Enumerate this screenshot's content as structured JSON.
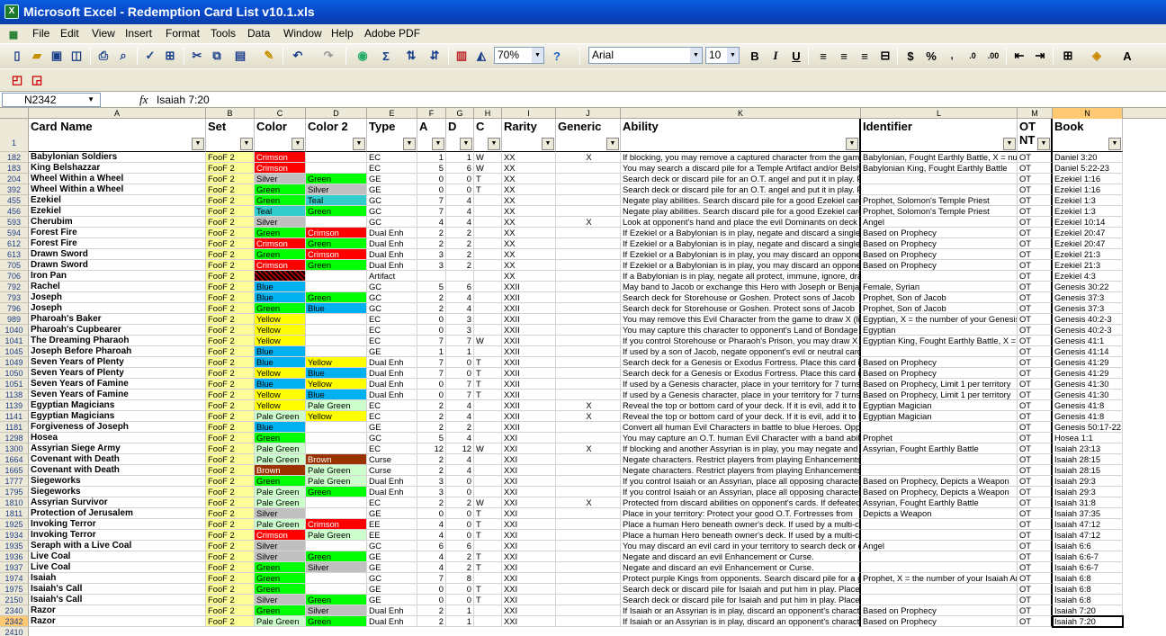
{
  "window": {
    "title": "Microsoft Excel - Redemption Card List v10.1.xls"
  },
  "menu": [
    "File",
    "Edit",
    "View",
    "Insert",
    "Format",
    "Tools",
    "Data",
    "Window",
    "Help",
    "Adobe PDF"
  ],
  "toolbar": {
    "zoom": "70%",
    "font": "Arial",
    "size": "10"
  },
  "formula_bar": {
    "name_box": "N2342",
    "fx": "fx",
    "value": "Isaiah 7:20"
  },
  "columns": [
    "A",
    "B",
    "C",
    "D",
    "E",
    "F",
    "G",
    "H",
    "I",
    "J",
    "K",
    "L",
    "M",
    "N"
  ],
  "headers": [
    "Card Name",
    "Set",
    "Color",
    "Color 2",
    "Type",
    "A",
    "D",
    "C",
    "Rarity",
    "Generic",
    "Ability",
    "Identifier",
    "OT NT",
    "Book"
  ],
  "header_row_num": "1",
  "last_row_num": "2410",
  "colors": {
    "Crimson": "#ff0000",
    "Silver": "#c0c0c0",
    "Green": "#00ff00",
    "Teal": "#33cccc",
    "Blue": "#00b0f0",
    "Yellow": "#ffff00",
    "Pale Green": "#ccffcc",
    "Brown": "#993300",
    "set": "#ffff99"
  },
  "rows": [
    {
      "n": "182",
      "name": "Babylonian Soldiers",
      "set": "FooF 2",
      "color": "Crimson",
      "color2": "",
      "type": "EC",
      "a": "1",
      "d": "1",
      "c": "W",
      "rarity": "XX",
      "generic": "X",
      "ability": "If blocking, you may remove a captured character from the game",
      "ident": "Babylonian, Fought Earthly Battle, X = num",
      "ot": "OT",
      "book": "Daniel 3:20"
    },
    {
      "n": "183",
      "name": "King Belshazzar",
      "set": "FooF 2",
      "color": "Crimson",
      "color2": "",
      "type": "EC",
      "a": "5",
      "d": "6",
      "c": "W",
      "rarity": "XX",
      "generic": "",
      "ability": "You may search a discard pile for a Temple Artifact and/or Belshazzar",
      "ident": "Babylonian King, Fought Earthly Battle",
      "ot": "OT",
      "book": "Daniel 5:22-23"
    },
    {
      "n": "204",
      "name": "Wheel Within a Wheel",
      "set": "FooF 2",
      "color": "Silver",
      "color2": "Green",
      "type": "GE",
      "a": "0",
      "d": "0",
      "c": "T",
      "rarity": "XX",
      "generic": "",
      "ability": "Search deck or discard pile for an O.T. angel and put it in play. Place",
      "ident": "",
      "ot": "OT",
      "book": "Ezekiel 1:16"
    },
    {
      "n": "392",
      "name": "Wheel Within a Wheel",
      "set": "FooF 2",
      "color": "Green",
      "color2": "Silver",
      "type": "GE",
      "a": "0",
      "d": "0",
      "c": "T",
      "rarity": "XX",
      "generic": "",
      "ability": "Search deck or discard pile for an O.T. angel and put it in play. Place",
      "ident": "",
      "ot": "OT",
      "book": "Ezekiel 1:16"
    },
    {
      "n": "455",
      "name": "Ezekiel",
      "set": "FooF 2",
      "color": "Green",
      "color2": "Teal",
      "type": "GC",
      "a": "7",
      "d": "4",
      "c": "",
      "rarity": "XX",
      "generic": "",
      "ability": "Negate play abilities. Search discard pile for a good Ezekiel card",
      "ident": "Prophet, Solomon's Temple Priest",
      "ot": "OT",
      "book": "Ezekiel 1:3"
    },
    {
      "n": "456",
      "name": "Ezekiel",
      "set": "FooF 2",
      "color": "Teal",
      "color2": "Green",
      "type": "GC",
      "a": "7",
      "d": "4",
      "c": "",
      "rarity": "XX",
      "generic": "",
      "ability": "Negate play abilities. Search discard pile for a good Ezekiel card",
      "ident": "Prophet, Solomon's Temple Priest",
      "ot": "OT",
      "book": "Ezekiel 1:3"
    },
    {
      "n": "593",
      "name": "Cherubim",
      "set": "FooF 2",
      "color": "Silver",
      "color2": "",
      "type": "GC",
      "a": "4",
      "d": "4",
      "c": "",
      "rarity": "XX",
      "generic": "X",
      "ability": "Look at opponent's hand and place the evil Dominants on deck",
      "ident": "Angel",
      "ot": "OT",
      "book": "Ezekiel 10:14"
    },
    {
      "n": "594",
      "name": "Forest Fire",
      "set": "FooF 2",
      "color": "Green",
      "color2": "Crimson",
      "type": "Dual Enh",
      "a": "2",
      "d": "2",
      "c": "",
      "rarity": "XX",
      "generic": "",
      "ability": "If Ezekiel or a Babylonian is in play, negate and discard a single card",
      "ident": "Based on Prophecy",
      "ot": "OT",
      "book": "Ezekiel 20:47"
    },
    {
      "n": "612",
      "name": "Forest Fire",
      "set": "FooF 2",
      "color": "Crimson",
      "color2": "Green",
      "type": "Dual Enh",
      "a": "2",
      "d": "2",
      "c": "",
      "rarity": "XX",
      "generic": "",
      "ability": "If Ezekiel or a Babylonian is in play, negate and discard a single card",
      "ident": "Based on Prophecy",
      "ot": "OT",
      "book": "Ezekiel 20:47"
    },
    {
      "n": "613",
      "name": "Drawn Sword",
      "set": "FooF 2",
      "color": "Green",
      "color2": "Crimson",
      "type": "Dual Enh",
      "a": "3",
      "d": "2",
      "c": "",
      "rarity": "XX",
      "generic": "",
      "ability": "If Ezekiel or a Babylonian is in play, you may discard an opponent's",
      "ident": "Based on Prophecy",
      "ot": "OT",
      "book": "Ezekiel 21:3"
    },
    {
      "n": "705",
      "name": "Drawn Sword",
      "set": "FooF 2",
      "color": "Crimson",
      "color2": "Green",
      "type": "Dual Enh",
      "a": "3",
      "d": "2",
      "c": "",
      "rarity": "XX",
      "generic": "",
      "ability": "If Ezekiel or a Babylonian is in play, you may discard an opponent's",
      "ident": "Based on Prophecy",
      "ot": "OT",
      "book": "Ezekiel 21:3"
    },
    {
      "n": "706",
      "name": "Iron Pan",
      "set": "FooF 2",
      "color": "hatch",
      "color2": "",
      "type": "Artifact",
      "a": "",
      "d": "",
      "c": "",
      "rarity": "XX",
      "generic": "",
      "ability": "If a Babylonian is in play, negate all protect, immune, ignore, draw",
      "ident": "",
      "ot": "OT",
      "book": "Ezekiel 4:3"
    },
    {
      "n": "792",
      "name": "Rachel",
      "set": "FooF 2",
      "color": "Blue",
      "color2": "",
      "type": "GC",
      "a": "5",
      "d": "6",
      "c": "",
      "rarity": "XXII",
      "generic": "",
      "ability": "May band to Jacob or exchange this Hero with Joseph or Benjamin",
      "ident": "Female, Syrian",
      "ot": "OT",
      "book": "Genesis 30:22"
    },
    {
      "n": "793",
      "name": "Joseph",
      "set": "FooF 2",
      "color": "Blue",
      "color2": "Green",
      "type": "GC",
      "a": "2",
      "d": "4",
      "c": "",
      "rarity": "XXII",
      "generic": "",
      "ability": "Search deck for Storehouse or Goshen. Protect sons of Jacob",
      "ident": "Prophet, Son of Jacob",
      "ot": "OT",
      "book": "Genesis 37:3"
    },
    {
      "n": "796",
      "name": "Joseph",
      "set": "FooF 2",
      "color": "Green",
      "color2": "Blue",
      "type": "GC",
      "a": "2",
      "d": "4",
      "c": "",
      "rarity": "XXII",
      "generic": "",
      "ability": "Search deck for Storehouse or Goshen. Protect sons of Jacob",
      "ident": "Prophet, Son of Jacob",
      "ot": "OT",
      "book": "Genesis 37:3"
    },
    {
      "n": "989",
      "name": "Pharoah's Baker",
      "set": "FooF 2",
      "color": "Yellow",
      "color2": "",
      "type": "EC",
      "a": "0",
      "d": "3",
      "c": "",
      "rarity": "XXII",
      "generic": "",
      "ability": "You may remove this Evil Character from the game to draw X (limit",
      "ident": "Egyptian, X = the number of your Genesis H",
      "ot": "OT",
      "book": "Genesis 40:2-3"
    },
    {
      "n": "1040",
      "name": "Pharoah's Cupbearer",
      "set": "FooF 2",
      "color": "Yellow",
      "color2": "",
      "type": "EC",
      "a": "0",
      "d": "3",
      "c": "",
      "rarity": "XXII",
      "generic": "",
      "ability": "You may capture this character to opponent's Land of Bondage",
      "ident": "Egyptian",
      "ot": "OT",
      "book": "Genesis 40:2-3"
    },
    {
      "n": "1041",
      "name": "The Dreaming Pharaoh",
      "set": "FooF 2",
      "color": "Yellow",
      "color2": "",
      "type": "EC",
      "a": "7",
      "d": "7",
      "c": "W",
      "rarity": "XXII",
      "generic": "",
      "ability": "If you control Storehouse or Pharaoh's Prison, you may draw X",
      "ident": "Egyptian King, Fought Earthly Battle, X = th",
      "ot": "OT",
      "book": "Genesis 41:1"
    },
    {
      "n": "1045",
      "name": "Joseph Before Pharoah",
      "set": "FooF 2",
      "color": "Blue",
      "color2": "",
      "type": "GE",
      "a": "1",
      "d": "1",
      "c": "",
      "rarity": "XXII",
      "generic": "",
      "ability": "If used by a son of Jacob, negate opponent's evil or neutral card",
      "ident": "",
      "ot": "OT",
      "book": "Genesis 41:14"
    },
    {
      "n": "1049",
      "name": "Seven Years of Plenty",
      "set": "FooF 2",
      "color": "Blue",
      "color2": "Yellow",
      "type": "Dual Enh",
      "a": "7",
      "d": "0",
      "c": "T",
      "rarity": "XXII",
      "generic": "",
      "ability": "Search deck for a Genesis or Exodus Fortress. Place this card in",
      "ident": "Based on Prophecy",
      "ot": "OT",
      "book": "Genesis 41:29"
    },
    {
      "n": "1050",
      "name": "Seven Years of Plenty",
      "set": "FooF 2",
      "color": "Yellow",
      "color2": "Blue",
      "type": "Dual Enh",
      "a": "7",
      "d": "0",
      "c": "T",
      "rarity": "XXII",
      "generic": "",
      "ability": "Search deck for a Genesis or Exodus Fortress. Place this card in",
      "ident": "Based on Prophecy",
      "ot": "OT",
      "book": "Genesis 41:29"
    },
    {
      "n": "1051",
      "name": "Seven Years of Famine",
      "set": "FooF 2",
      "color": "Blue",
      "color2": "Yellow",
      "type": "Dual Enh",
      "a": "0",
      "d": "7",
      "c": "T",
      "rarity": "XXII",
      "generic": "",
      "ability": "If used by a Genesis character, place in your territory for 7 turns:",
      "ident": "Based on Prophecy, Limit 1 per territory",
      "ot": "OT",
      "book": "Genesis 41:30"
    },
    {
      "n": "1138",
      "name": "Seven Years of Famine",
      "set": "FooF 2",
      "color": "Yellow",
      "color2": "Blue",
      "type": "Dual Enh",
      "a": "0",
      "d": "7",
      "c": "T",
      "rarity": "XXII",
      "generic": "",
      "ability": "If used by a Genesis character, place in your territory for 7 turns:",
      "ident": "Based on Prophecy, Limit 1 per territory",
      "ot": "OT",
      "book": "Genesis 41:30"
    },
    {
      "n": "1139",
      "name": "Egyptian Magicians",
      "set": "FooF 2",
      "color": "Yellow",
      "color2": "Pale Green",
      "type": "EC",
      "a": "2",
      "d": "4",
      "c": "",
      "rarity": "XXII",
      "generic": "X",
      "ability": "Reveal the top or bottom card of your deck. If it is evil, add it to hand",
      "ident": "Egyptian Magician",
      "ot": "OT",
      "book": "Genesis 41:8"
    },
    {
      "n": "1141",
      "name": "Egyptian Magicians",
      "set": "FooF 2",
      "color": "Pale Green",
      "color2": "Yellow",
      "type": "EC",
      "a": "2",
      "d": "4",
      "c": "",
      "rarity": "XXII",
      "generic": "X",
      "ability": "Reveal the top or bottom card of your deck. If it is evil, add it to hand",
      "ident": "Egyptian Magician",
      "ot": "OT",
      "book": "Genesis 41:8"
    },
    {
      "n": "1181",
      "name": "Forgiveness of Joseph",
      "set": "FooF 2",
      "color": "Blue",
      "color2": "",
      "type": "GE",
      "a": "2",
      "d": "2",
      "c": "",
      "rarity": "XXII",
      "generic": "",
      "ability": "Convert all human Evil Characters in battle to blue Heroes. Oppo",
      "ident": "",
      "ot": "OT",
      "book": "Genesis 50:17-22"
    },
    {
      "n": "1298",
      "name": "Hosea",
      "set": "FooF 2",
      "color": "Green",
      "color2": "",
      "type": "GC",
      "a": "5",
      "d": "4",
      "c": "",
      "rarity": "XXI",
      "generic": "",
      "ability": "You may capture an O.T. human Evil Character with a band ability",
      "ident": "Prophet",
      "ot": "OT",
      "book": "Hosea 1:1"
    },
    {
      "n": "1300",
      "name": "Assyrian Siege Army",
      "set": "FooF 2",
      "color": "Pale Green",
      "color2": "",
      "type": "EC",
      "a": "12",
      "d": "12",
      "c": "W",
      "rarity": "XXI",
      "generic": "X",
      "ability": "If blocking and another Assyrian is in play, you may negate and di",
      "ident": "Assyrian, Fought Earthly Battle",
      "ot": "OT",
      "book": "Isaiah 23:13"
    },
    {
      "n": "1664",
      "name": "Covenant with Death",
      "set": "FooF 2",
      "color": "Pale Green",
      "color2": "Brown",
      "type": "Curse",
      "a": "2",
      "d": "4",
      "c": "",
      "rarity": "XXI",
      "generic": "",
      "ability": "Negate characters. Restrict players from playing Enhancements",
      "ident": "",
      "ot": "OT",
      "book": "Isaiah 28:15"
    },
    {
      "n": "1665",
      "name": "Covenant with Death",
      "set": "FooF 2",
      "color": "Brown",
      "color2": "Pale Green",
      "type": "Curse",
      "a": "2",
      "d": "4",
      "c": "",
      "rarity": "XXI",
      "generic": "",
      "ability": "Negate characters. Restrict players from playing Enhancements",
      "ident": "",
      "ot": "OT",
      "book": "Isaiah 28:15"
    },
    {
      "n": "1777",
      "name": "Siegeworks",
      "set": "FooF 2",
      "color": "Green",
      "color2": "Pale Green",
      "type": "Dual Enh",
      "a": "3",
      "d": "0",
      "c": "",
      "rarity": "XXI",
      "generic": "",
      "ability": "If you control Isaiah or an Assyrian, place all opposing characters",
      "ident": "Based on Prophecy, Depicts a Weapon",
      "ot": "OT",
      "book": "Isaiah 29:3"
    },
    {
      "n": "1795",
      "name": "Siegeworks",
      "set": "FooF 2",
      "color": "Pale Green",
      "color2": "Green",
      "type": "Dual Enh",
      "a": "3",
      "d": "0",
      "c": "",
      "rarity": "XXI",
      "generic": "",
      "ability": "If you control Isaiah or an Assyrian, place all opposing characters",
      "ident": "Based on Prophecy, Depicts a Weapon",
      "ot": "OT",
      "book": "Isaiah 29:3"
    },
    {
      "n": "1810",
      "name": "Assyrian Survivor",
      "set": "FooF 2",
      "color": "Pale Green",
      "color2": "",
      "type": "EC",
      "a": "2",
      "d": "2",
      "c": "W",
      "rarity": "XXI",
      "generic": "X",
      "ability": "Protected from discard abilities on opponent's cards. If defeated",
      "ident": "Assyrian, Fought Earthly Battle",
      "ot": "OT",
      "book": "Isaiah 31:8"
    },
    {
      "n": "1811",
      "name": "Protection of Jerusalem",
      "set": "FooF 2",
      "color": "Silver",
      "color2": "",
      "type": "GE",
      "a": "0",
      "d": "0",
      "c": "T",
      "rarity": "XXI",
      "generic": "",
      "ability": "Place in your territory: Protect your good O.T. Fortresses from",
      "ident": "Depicts a Weapon",
      "ot": "OT",
      "book": "Isaiah 37:35"
    },
    {
      "n": "1925",
      "name": "Invoking Terror",
      "set": "FooF 2",
      "color": "Pale Green",
      "color2": "Crimson",
      "type": "EE",
      "a": "4",
      "d": "0",
      "c": "T",
      "rarity": "XXI",
      "generic": "",
      "ability": "Place a human Hero beneath owner's deck. If used by a multi-color",
      "ident": "",
      "ot": "OT",
      "book": "Isaiah 47:12"
    },
    {
      "n": "1934",
      "name": "Invoking Terror",
      "set": "FooF 2",
      "color": "Crimson",
      "color2": "Pale Green",
      "type": "EE",
      "a": "4",
      "d": "0",
      "c": "T",
      "rarity": "XXI",
      "generic": "",
      "ability": "Place a human Hero beneath owner's deck. If used by a multi-color",
      "ident": "",
      "ot": "OT",
      "book": "Isaiah 47:12"
    },
    {
      "n": "1935",
      "name": "Seraph with a Live Coal",
      "set": "FooF 2",
      "color": "Silver",
      "color2": "",
      "type": "GC",
      "a": "6",
      "d": "6",
      "c": "",
      "rarity": "XXI",
      "generic": "",
      "ability": "You may discard an evil card in your territory to search deck or di",
      "ident": "Angel",
      "ot": "OT",
      "book": "Isaiah 6:6"
    },
    {
      "n": "1936",
      "name": "Live Coal",
      "set": "FooF 2",
      "color": "Silver",
      "color2": "Green",
      "type": "GE",
      "a": "4",
      "d": "2",
      "c": "T",
      "rarity": "XXI",
      "generic": "",
      "ability": "Negate and discard an evil Enhancement or Curse.",
      "ident": "",
      "ot": "OT",
      "book": "Isaiah 6:6-7"
    },
    {
      "n": "1937",
      "name": "Live Coal",
      "set": "FooF 2",
      "color": "Green",
      "color2": "Silver",
      "type": "GE",
      "a": "4",
      "d": "2",
      "c": "T",
      "rarity": "XXI",
      "generic": "",
      "ability": "Negate and discard an evil Enhancement or Curse.",
      "ident": "",
      "ot": "OT",
      "book": "Isaiah 6:6-7"
    },
    {
      "n": "1974",
      "name": "Isaiah",
      "set": "FooF 2",
      "color": "Green",
      "color2": "",
      "type": "GC",
      "a": "7",
      "d": "8",
      "c": "",
      "rarity": "XXI",
      "generic": "",
      "ability": "Protect purple Kings from opponents. Search discard pile for a good",
      "ident": "Prophet, X = the number of your Isaiah And",
      "ot": "OT",
      "book": "Isaiah 6:8"
    },
    {
      "n": "1975",
      "name": "Isaiah's Call",
      "set": "FooF 2",
      "color": "Green",
      "color2": "",
      "type": "GE",
      "a": "0",
      "d": "0",
      "c": "T",
      "rarity": "XXI",
      "generic": "",
      "ability": "Search deck or discard pile for Isaiah and put him in play. Place co",
      "ident": "",
      "ot": "OT",
      "book": "Isaiah 6:8"
    },
    {
      "n": "2150",
      "name": "Isaiah's Call",
      "set": "FooF 2",
      "color": "Silver",
      "color2": "Green",
      "type": "GE",
      "a": "0",
      "d": "0",
      "c": "T",
      "rarity": "XXI",
      "generic": "",
      "ability": "Search deck or discard pile for Isaiah and put him in play. Place co",
      "ident": "",
      "ot": "OT",
      "book": "Isaiah 6:8"
    },
    {
      "n": "2340",
      "name": "Razor",
      "set": "FooF 2",
      "color": "Green",
      "color2": "Silver",
      "type": "Dual Enh",
      "a": "2",
      "d": "1",
      "c": "",
      "rarity": "XXI",
      "generic": "",
      "ability": "If Isaiah or an Assyrian is in play, discard an opponent's character",
      "ident": "Based on Prophecy",
      "ot": "OT",
      "book": "Isaiah 7:20"
    },
    {
      "n": "2342",
      "name": "Razor",
      "set": "FooF 2",
      "color": "Pale Green",
      "color2": "Green",
      "type": "Dual Enh",
      "a": "2",
      "d": "1",
      "c": "",
      "rarity": "XXI",
      "generic": "",
      "ability": "If Isaiah or an Assyrian is in play, discard an opponent's character",
      "ident": "Based on Prophecy",
      "ot": "OT",
      "book": "Isaiah 7:20"
    }
  ]
}
